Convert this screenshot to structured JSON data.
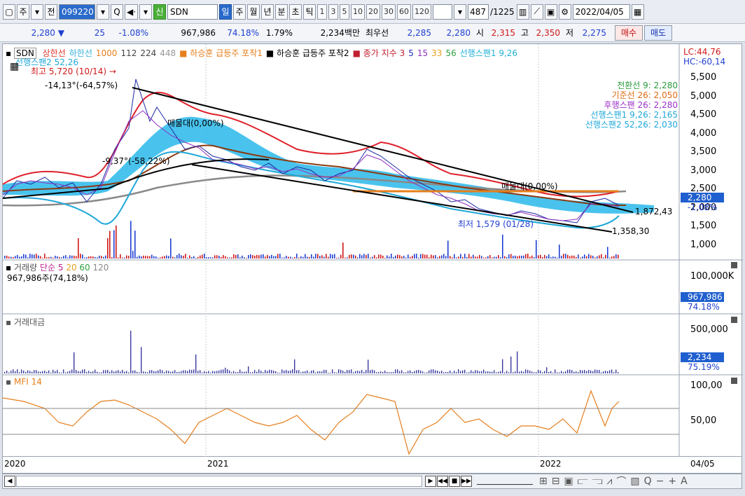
{
  "toolbar": {
    "window_icon": "window-icon",
    "market": "주",
    "price_btn": "전",
    "code": "099220",
    "mode_search": "Q",
    "mode_audio": "◀·",
    "credit": "신",
    "name": "SDN",
    "periods": [
      "일",
      "주",
      "월",
      "년",
      "분",
      "초",
      "틱"
    ],
    "intervals": [
      "1",
      "3",
      "5",
      "10",
      "20",
      "30",
      "60",
      "120"
    ],
    "counter": "487",
    "total": "/1225",
    "date": "2022/04/05"
  },
  "quote": {
    "price": "2,280",
    "arrow": "▼",
    "change": "25",
    "pct": "-1.08%",
    "volume": "967,986",
    "vol_ratio": "74.18%",
    "turnover": "1.79%",
    "amount": "2,234백만",
    "best_label": "최우선",
    "ask": "2,285",
    "bid": "2,280",
    "open_label": "시",
    "open": "2,315",
    "high_label": "고",
    "high": "2,350",
    "low_label": "저",
    "low": "2,275",
    "buy": "매수",
    "sell": "매도"
  },
  "legend": {
    "name": "SDN",
    "items": [
      {
        "t": "상한선",
        "c": "#e0342a"
      },
      {
        "t": "하한선",
        "c": "#35b0d8"
      },
      {
        "t": "1000",
        "c": "#e67f1c"
      },
      {
        "t": "112",
        "c": "#444"
      },
      {
        "t": "224",
        "c": "#444"
      },
      {
        "t": "448",
        "c": "#999"
      },
      {
        "t": "■ 하승훈 급등주 포착1",
        "c": "#e67f1c"
      },
      {
        "t": "■ 하승훈 급등주 포착2",
        "c": "#000"
      },
      {
        "t": "■ 종가 지수 3",
        "c": "#c02030"
      },
      {
        "t": "5",
        "c": "#2030c0"
      },
      {
        "t": "15",
        "c": "#9030c0"
      },
      {
        "t": "33",
        "c": "#e6a020"
      },
      {
        "t": "56",
        "c": "#30a040"
      },
      {
        "t": "선행스팬1 9,26",
        "c": "#20b0d8"
      }
    ],
    "line2": "선행스팬2 52,26",
    "lc": "LC:44,76",
    "hc": "HC:-60,14"
  },
  "annotations": {
    "high": "최고 5,720 (10/14)",
    "high_arrow": "→",
    "pct1": "-14,13°(-64,57%)",
    "pct2": "-9,37°(-58,22%)",
    "vp1": "매물대(0,00%)",
    "vp2": "매물대(0,00%)",
    "low": "최저 1,579 (01/28)",
    "line1": "1,872,43",
    "line2": "1,358,30"
  },
  "ichimoku": [
    {
      "t": "전환선 9: 2,280",
      "c": "#2a9b3c"
    },
    {
      "t": "기준선 26: 2,050",
      "c": "#e06a10"
    },
    {
      "t": "후행스팬 26: 2,280",
      "c": "#9b30c8"
    },
    {
      "t": "선행스팬1 9,26: 2,165",
      "c": "#1fa8d8"
    },
    {
      "t": "선행스팬2 52,26: 2,030",
      "c": "#1fa8d8"
    }
  ],
  "price_axis": {
    "ticks": [
      "5,500",
      "5,000",
      "4,500",
      "4,000",
      "3,500",
      "3,000",
      "2,500",
      "2,000",
      "1,500",
      "1,000"
    ],
    "current": "2,280",
    "current_pct": "-1.08%"
  },
  "volume": {
    "title": "거래량",
    "ma_label": "단순",
    "ma": [
      "5",
      "20",
      "60",
      "120"
    ],
    "value": "967,986주(74,18%)",
    "tick": "100,000K",
    "current": "967,986",
    "current_pct": "74.18%"
  },
  "amount": {
    "title": "거래대금",
    "tick": "500,000",
    "current": "2,234",
    "current_pct": "75.19%"
  },
  "mfi": {
    "title": "MFI 14",
    "ticks": [
      "100,00",
      "50,00"
    ]
  },
  "date_axis": {
    "labels": [
      "2020",
      "2021",
      "2022"
    ],
    "last": "04/05"
  },
  "bottom": {
    "scroll_left": "◀",
    "nav": [
      "▶",
      "◀◀",
      "■",
      "▶▶"
    ],
    "tools": [
      "⊞",
      "⊟",
      "▣",
      "⫍",
      "⫎",
      "⩘",
      "⌒",
      "▧",
      "Q",
      "−",
      "+",
      "A"
    ]
  }
}
